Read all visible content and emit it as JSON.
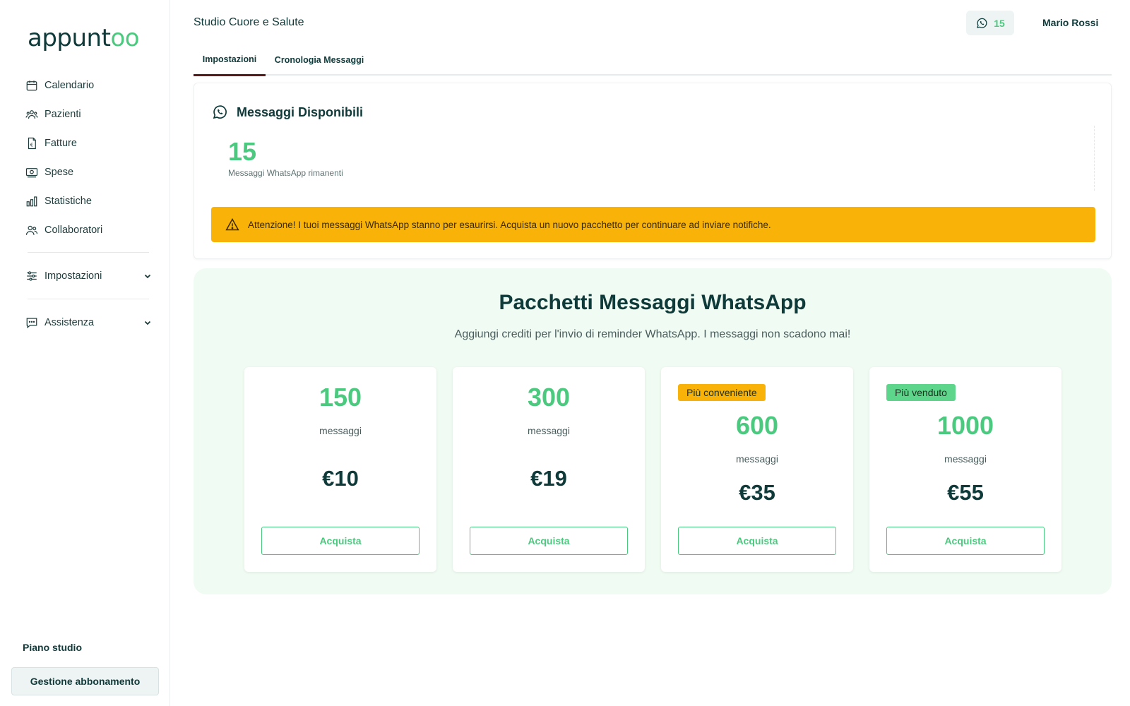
{
  "app": {
    "logo_main": "appunt",
    "logo_accent": "oo"
  },
  "sidebar": {
    "items": [
      {
        "label": "Calendario",
        "icon": "calendar-icon"
      },
      {
        "label": "Pazienti",
        "icon": "patients-icon"
      },
      {
        "label": "Fatture",
        "icon": "invoice-icon"
      },
      {
        "label": "Spese",
        "icon": "money-icon"
      },
      {
        "label": "Statistiche",
        "icon": "bar-chart-icon"
      },
      {
        "label": "Collaboratori",
        "icon": "users-icon"
      }
    ],
    "settings": {
      "label": "Impostazioni",
      "icon": "sliders-icon"
    },
    "support": {
      "label": "Assistenza",
      "icon": "chat-icon"
    },
    "plan_title": "Piano studio",
    "plan_button": "Gestione abbonamento"
  },
  "header": {
    "studio_name": "Studio Cuore e Salute",
    "whatsapp_count": "15",
    "user_name": "Mario Rossi"
  },
  "tabs": [
    {
      "label": "Impostazioni",
      "active": true
    },
    {
      "label": "Cronologia Messaggi",
      "active": false
    }
  ],
  "available": {
    "title": "Messaggi Disponibili",
    "count": "15",
    "subtitle": "Messaggi WhatsApp rimanenti",
    "alert": "Attenzione! I tuoi messaggi WhatsApp stanno per esaurirsi. Acquista un nuovo pacchetto per continuare ad inviare notifiche."
  },
  "packages": {
    "title": "Pacchetti Messaggi WhatsApp",
    "subtitle": "Aggiungi crediti per l'invio di reminder WhatsApp. I messaggi non scadono mai!",
    "items": [
      {
        "qty": "150",
        "unit": "messaggi",
        "price": "€10",
        "button": "Acquista",
        "badge": ""
      },
      {
        "qty": "300",
        "unit": "messaggi",
        "price": "€19",
        "button": "Acquista",
        "badge": ""
      },
      {
        "qty": "600",
        "unit": "messaggi",
        "price": "€35",
        "button": "Acquista",
        "badge": "Più conveniente"
      },
      {
        "qty": "1000",
        "unit": "messaggi",
        "price": "€55",
        "button": "Acquista",
        "badge": "Più venduto"
      }
    ]
  },
  "colors": {
    "accent": "#4bc97e",
    "dark": "#0f3a3a",
    "warning": "#f9b308",
    "tab_active": "#5a1a1a"
  }
}
